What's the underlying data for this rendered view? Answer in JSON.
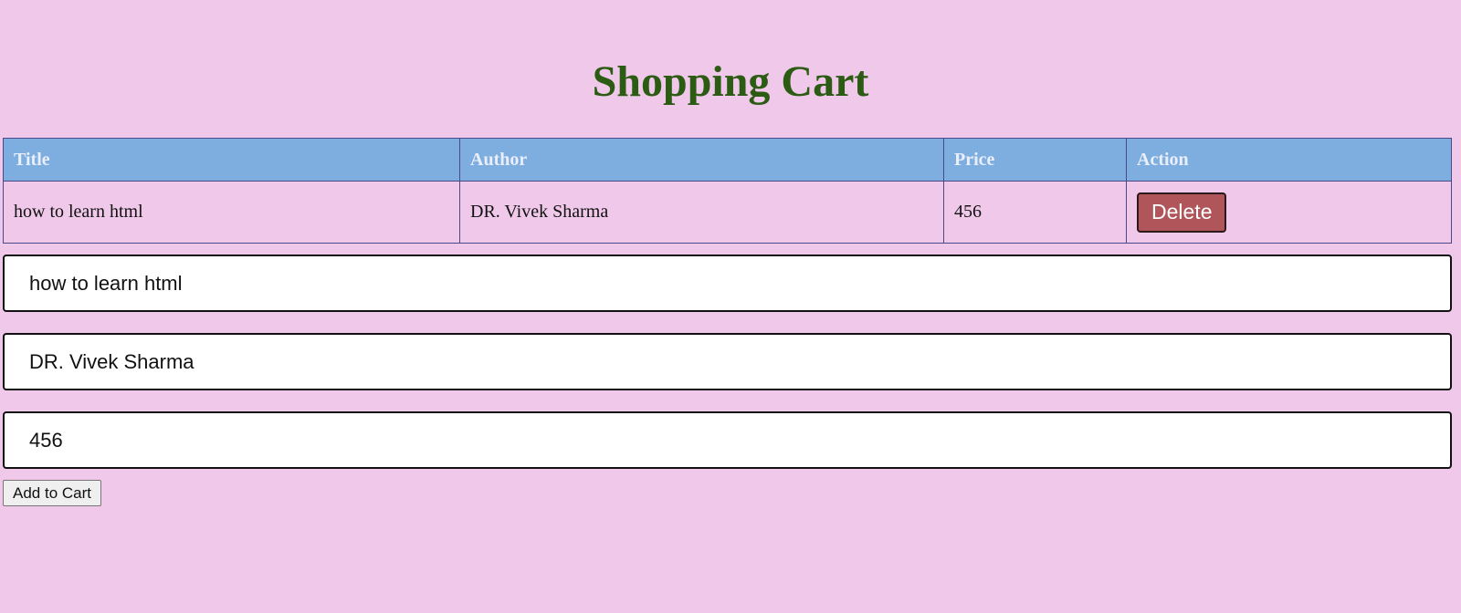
{
  "page": {
    "title": "Shopping Cart",
    "background_color": "#f0c9ea",
    "title_color": "#2c5b14"
  },
  "table": {
    "header_color": "#7eaedf",
    "headers": [
      "Title",
      "Author",
      "Price",
      "Action"
    ],
    "rows": [
      {
        "title": "how to learn html",
        "author": "DR. Vivek Sharma",
        "price": "456",
        "action_label": "Delete"
      }
    ]
  },
  "form": {
    "title_value": "how to learn html",
    "author_value": "DR. Vivek Sharma",
    "price_value": "456",
    "submit_label": "Add to Cart"
  },
  "colors": {
    "delete_button": "#b0565b"
  }
}
